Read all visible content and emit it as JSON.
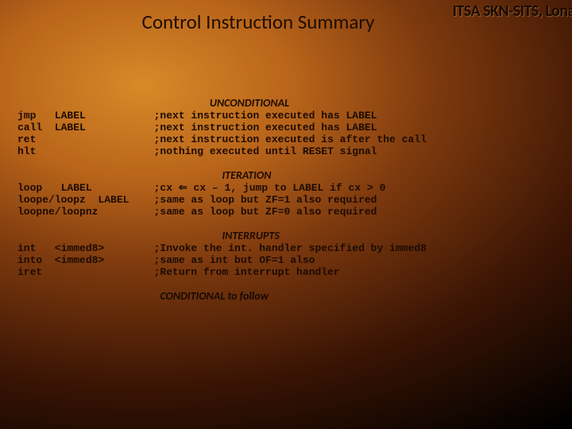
{
  "brand": "ITSA SKN-SITS, Lona",
  "title": "Control Instruction Summary",
  "sections": {
    "unconditional": {
      "header": "UNCONDITIONAL",
      "lines": [
        "jmp   LABEL           ;next instruction executed has LABEL",
        "call  LABEL           ;next instruction executed has LABEL",
        "ret                   ;next instruction executed is after the call",
        "hlt                   ;nothing executed until RESET signal"
      ]
    },
    "iteration": {
      "header": "ITERATION",
      "lines": [
        "loop   LABEL          ;cx ⇐ cx – 1, jump to LABEL if cx > 0",
        "loope/loopz  LABEL    ;same as loop but ZF=1 also required",
        "loopne/loopnz         ;same as loop but ZF=0 also required"
      ]
    },
    "interrupts": {
      "header": "INTERRUPTS",
      "lines": [
        "int   <immed8>        ;Invoke the int. handler specified by immed8",
        "into  <immed8>        ;same as int but OF=1 also",
        "iret                  ;Return from interrupt handler"
      ]
    }
  },
  "footer": "CONDITIONAL to follow"
}
